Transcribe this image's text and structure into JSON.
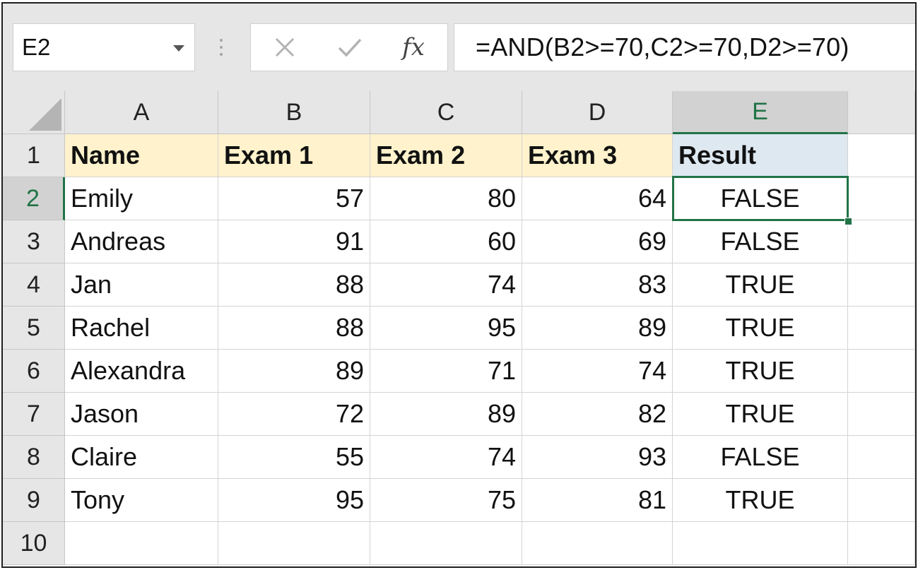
{
  "name_box": {
    "value": "E2"
  },
  "formula_bar": {
    "insert_function_label": "fx",
    "formula": "=AND(B2>=70,C2>=70,D2>=70)"
  },
  "columns": [
    "A",
    "B",
    "C",
    "D",
    "E"
  ],
  "row_numbers": [
    "1",
    "2",
    "3",
    "4",
    "5",
    "6",
    "7",
    "8",
    "9",
    "10"
  ],
  "headers": [
    "Name",
    "Exam 1",
    "Exam 2",
    "Exam 3",
    "Result"
  ],
  "rows": [
    [
      "Emily",
      "57",
      "80",
      "64",
      "FALSE"
    ],
    [
      "Andreas",
      "91",
      "60",
      "69",
      "FALSE"
    ],
    [
      "Jan",
      "88",
      "74",
      "83",
      "TRUE"
    ],
    [
      "Rachel",
      "88",
      "95",
      "89",
      "TRUE"
    ],
    [
      "Alexandra",
      "89",
      "71",
      "74",
      "TRUE"
    ],
    [
      "Jason",
      "72",
      "89",
      "82",
      "TRUE"
    ],
    [
      "Claire",
      "55",
      "74",
      "93",
      "FALSE"
    ],
    [
      "Tony",
      "95",
      "75",
      "81",
      "TRUE"
    ]
  ],
  "active_cell": "E2",
  "colors": {
    "selection": "#217346",
    "header_fill": "#fff2cc",
    "result_header_fill": "#dde8f1"
  }
}
